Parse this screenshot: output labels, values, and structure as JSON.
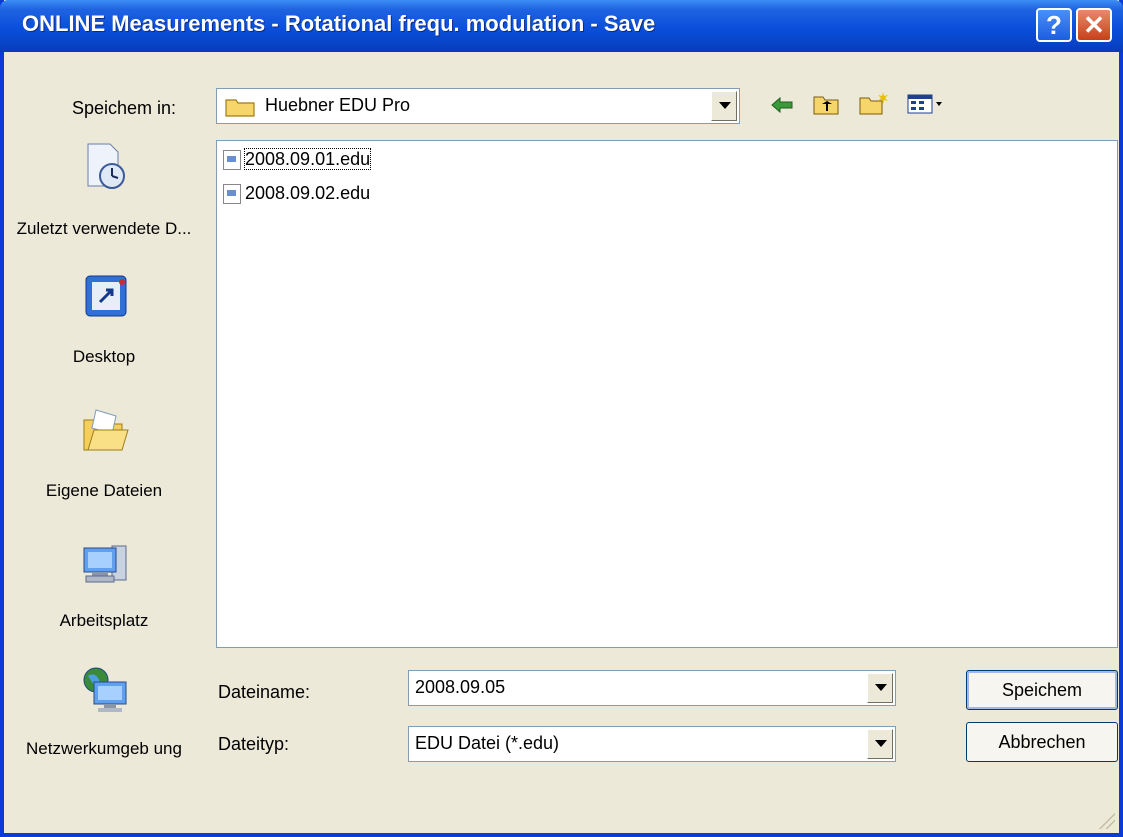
{
  "window": {
    "title": "ONLINE Measurements - Rotational frequ. modulation - Save"
  },
  "toolbar": {
    "save_in_label": "Speichem in:",
    "location": "Huebner EDU Pro",
    "icons": [
      "back-icon",
      "up-folder-icon",
      "new-folder-icon",
      "view-menu-icon"
    ]
  },
  "places": [
    {
      "label": "Zuletzt verwendete D...",
      "icon": "recent-documents-icon"
    },
    {
      "label": "Desktop",
      "icon": "desktop-icon"
    },
    {
      "label": "Eigene Dateien",
      "icon": "my-documents-icon"
    },
    {
      "label": "Arbeitsplatz",
      "icon": "my-computer-icon"
    },
    {
      "label": "Netzwerkumgeb ung",
      "icon": "network-icon"
    }
  ],
  "files": [
    {
      "name": "2008.09.01.edu",
      "selected": true
    },
    {
      "name": "2008.09.02.edu",
      "selected": false
    }
  ],
  "form": {
    "filename_label": "Dateiname:",
    "filename_value": "2008.09.05",
    "filetype_label": "Dateityp:",
    "filetype_value": "EDU Datei (*.edu)"
  },
  "buttons": {
    "save": "Speichem",
    "cancel": "Abbrechen"
  },
  "colors": {
    "titlebar": "#0a4fdb",
    "dialog_bg": "#ece9d8",
    "close": "#c7401c"
  }
}
